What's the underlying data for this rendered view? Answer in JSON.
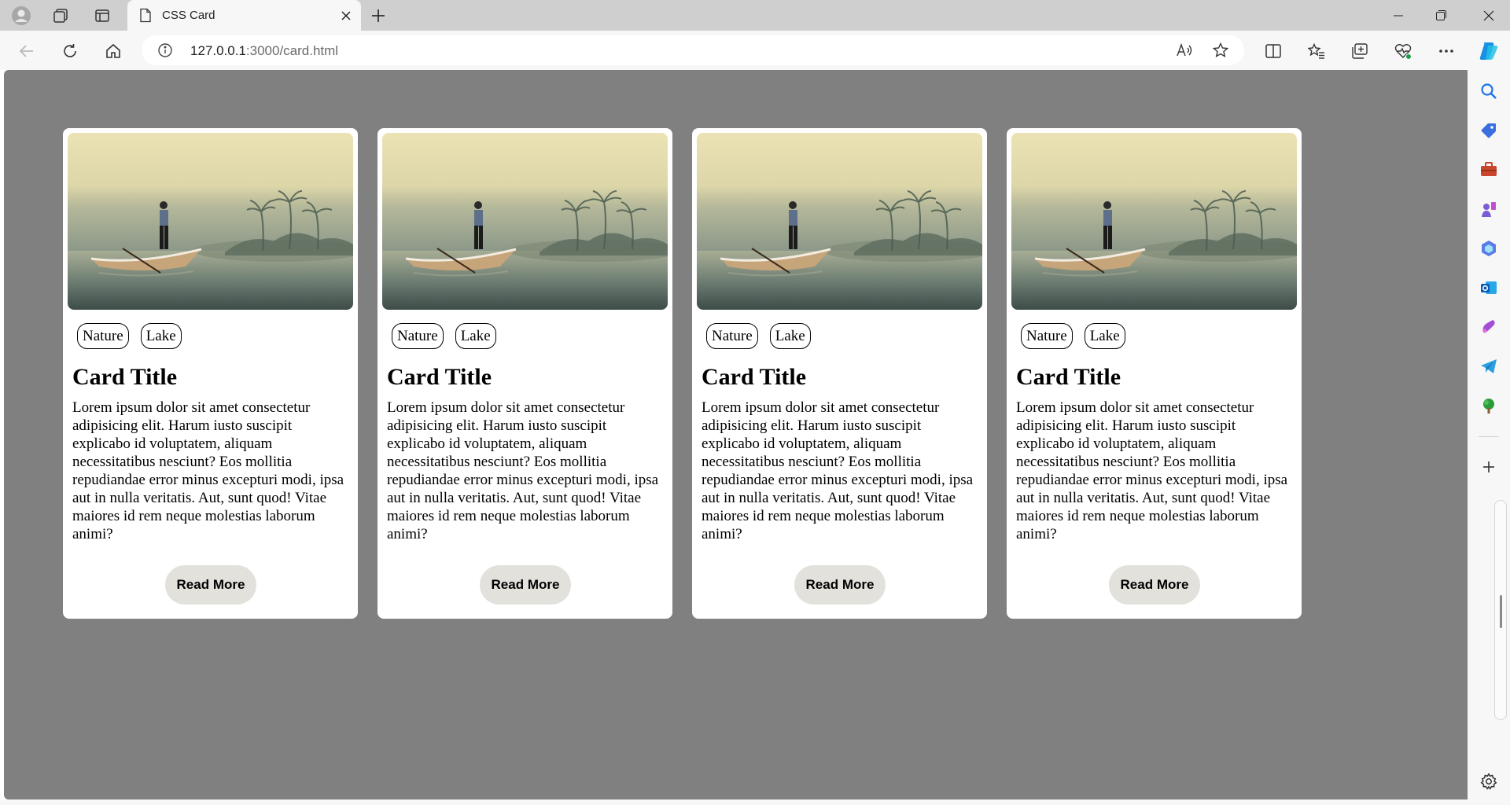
{
  "browser": {
    "tab": {
      "title": "CSS Card"
    },
    "address": {
      "url_host": "127.0.0.1",
      "url_rest": ":3000/card.html"
    },
    "icons": {
      "profile": "profile-icon",
      "workspaces": "workspaces-icon",
      "tab_actions": "vertical-tabs-icon",
      "new_tab": "plus-icon",
      "back": "back-arrow-icon",
      "refresh": "refresh-icon",
      "home": "home-icon",
      "read_aloud": "read-aloud-icon",
      "favorite": "star-icon",
      "split_screen": "split-screen-icon",
      "favorites": "favorites-icon",
      "collections": "collections-icon",
      "performance": "heart-pulse-icon",
      "more": "more-icon",
      "copilot": "copilot-icon"
    },
    "sidebar_icons": [
      "search-icon",
      "shopping-tag-icon",
      "tools-icon",
      "games-icon",
      "microsoft-365-icon",
      "outlook-icon",
      "designer-icon",
      "telegram-icon",
      "tree-icon",
      "add-icon",
      "settings-icon"
    ]
  },
  "page": {
    "background": "#808080",
    "cards": [
      {
        "tags": [
          "Nature",
          "Lake"
        ],
        "title": "Card Title",
        "text": "Lorem ipsum dolor sit amet consectetur adipisicing elit. Harum iusto suscipit explicabo id voluptatem, aliquam necessitatibus nesciunt? Eos mollitia repudiandae error minus excepturi modi, ipsa aut in nulla veritatis. Aut, sunt quod! Vitae maiores id rem neque molestias laborum animi?",
        "button": "Read More"
      },
      {
        "tags": [
          "Nature",
          "Lake"
        ],
        "title": "Card Title",
        "text": "Lorem ipsum dolor sit amet consectetur adipisicing elit. Harum iusto suscipit explicabo id voluptatem, aliquam necessitatibus nesciunt? Eos mollitia repudiandae error minus excepturi modi, ipsa aut in nulla veritatis. Aut, sunt quod! Vitae maiores id rem neque molestias laborum animi?",
        "button": "Read More"
      },
      {
        "tags": [
          "Nature",
          "Lake"
        ],
        "title": "Card Title",
        "text": "Lorem ipsum dolor sit amet consectetur adipisicing elit. Harum iusto suscipit explicabo id voluptatem, aliquam necessitatibus nesciunt? Eos mollitia repudiandae error minus excepturi modi, ipsa aut in nulla veritatis. Aut, sunt quod! Vitae maiores id rem neque molestias laborum animi?",
        "button": "Read More"
      },
      {
        "tags": [
          "Nature",
          "Lake"
        ],
        "title": "Card Title",
        "text": "Lorem ipsum dolor sit amet consectetur adipisicing elit. Harum iusto suscipit explicabo id voluptatem, aliquam necessitatibus nesciunt? Eos mollitia repudiandae error minus excepturi modi, ipsa aut in nulla veritatis. Aut, sunt quod! Vitae maiores id rem neque molestias laborum animi?",
        "button": "Read More"
      }
    ]
  }
}
